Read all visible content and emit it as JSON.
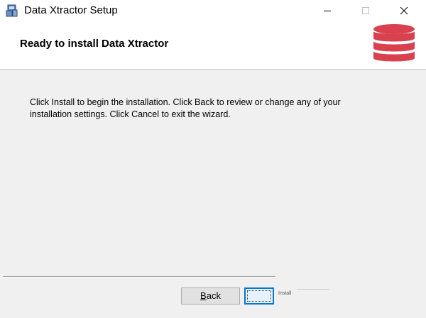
{
  "window": {
    "title": "Data Xtractor Setup",
    "icon": "installer-icon"
  },
  "controls": {
    "minimize_icon": "minimize-icon",
    "maximize_icon": "maximize-icon",
    "close_icon": "close-icon"
  },
  "banner": {
    "title": "Ready to install Data Xtractor",
    "icon": "database-icon",
    "icon_color": "#d9414f"
  },
  "body": {
    "message": "Click Install to begin the installation. Click Back to review or change any of your installation settings. Click Cancel to exit the wizard."
  },
  "buttons": {
    "back_label_accel": "B",
    "back_label_rest": "ack",
    "install_label": "Install",
    "focus_color": "#0078d7"
  }
}
